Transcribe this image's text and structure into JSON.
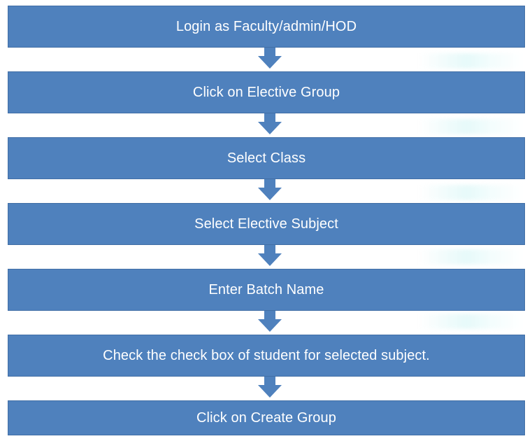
{
  "flowchart": {
    "steps": [
      {
        "label": "Login as Faculty/admin/HOD"
      },
      {
        "label": "Click on Elective Group"
      },
      {
        "label": "Select Class"
      },
      {
        "label": "Select Elective Subject"
      },
      {
        "label": "Enter Batch Name"
      },
      {
        "label": "Check the check box of student for selected subject."
      },
      {
        "label": "Click on Create Group"
      }
    ],
    "colors": {
      "box_fill": "#4f81bd",
      "box_border": "#416fa6",
      "box_text": "#ffffff",
      "arrow_fill": "#4f81bd"
    }
  }
}
